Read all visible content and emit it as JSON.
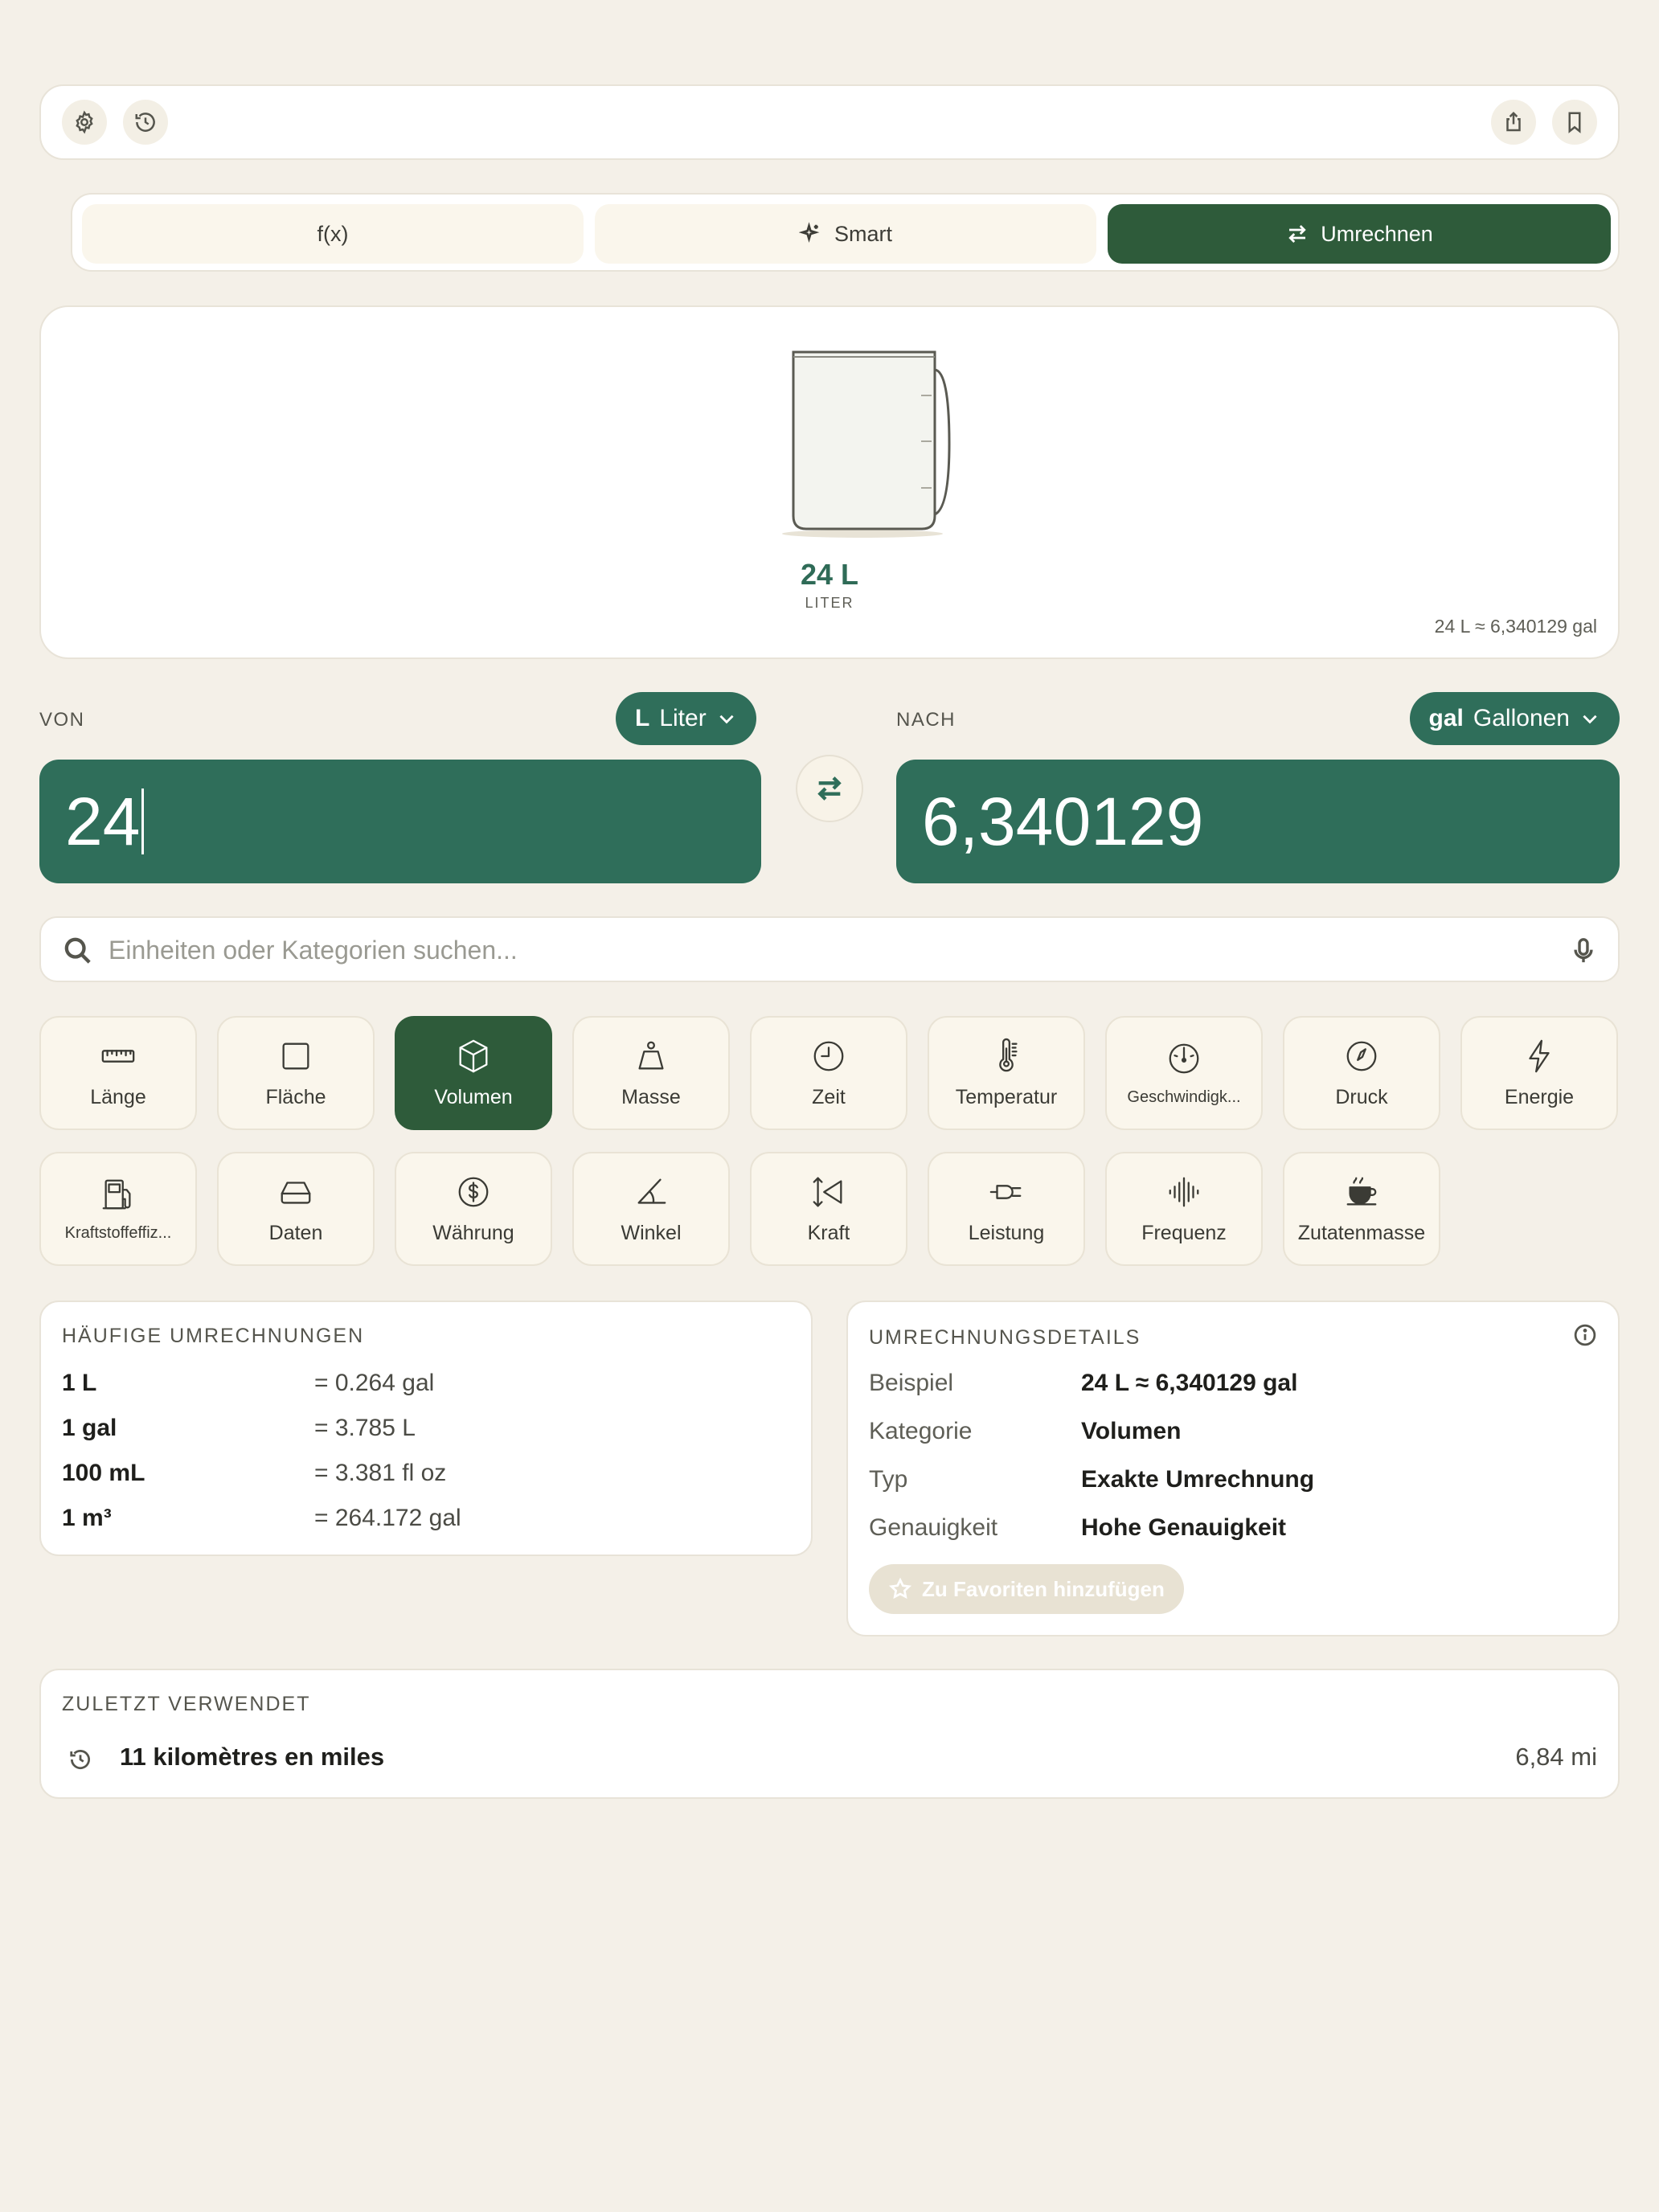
{
  "mode_tabs": [
    {
      "label": "f(x)"
    },
    {
      "label": "Smart"
    },
    {
      "label": "Umrechnen"
    }
  ],
  "visual": {
    "value": "24 L",
    "unit": "LITER",
    "approx": "24 L ≈ 6,340129 gal"
  },
  "from": {
    "label": "VON",
    "unit_symbol": "L",
    "unit_name": "Liter",
    "value": "24"
  },
  "to": {
    "label": "NACH",
    "unit_symbol": "gal",
    "unit_name": "Gallonen",
    "value": "6,340129"
  },
  "search": {
    "placeholder": "Einheiten oder Kategorien suchen..."
  },
  "categories": [
    {
      "label": "Länge",
      "icon": "ruler-icon"
    },
    {
      "label": "Fläche",
      "icon": "square-icon"
    },
    {
      "label": "Volumen",
      "icon": "cube-icon",
      "active": true
    },
    {
      "label": "Masse",
      "icon": "weight-icon"
    },
    {
      "label": "Zeit",
      "icon": "clock-icon"
    },
    {
      "label": "Temperatur",
      "icon": "thermometer-icon"
    },
    {
      "label": "Geschwindigk...",
      "icon": "speedometer-icon"
    },
    {
      "label": "Druck",
      "icon": "gauge-icon"
    },
    {
      "label": "Energie",
      "icon": "bolt-icon"
    },
    {
      "label": "Kraftstoffeffiz...",
      "icon": "fuel-icon"
    },
    {
      "label": "Daten",
      "icon": "drive-icon"
    },
    {
      "label": "Währung",
      "icon": "dollar-icon"
    },
    {
      "label": "Winkel",
      "icon": "angle-icon"
    },
    {
      "label": "Kraft",
      "icon": "force-icon"
    },
    {
      "label": "Leistung",
      "icon": "plug-icon"
    },
    {
      "label": "Frequenz",
      "icon": "waveform-icon"
    },
    {
      "label": "Zutatenmasse",
      "icon": "cup-icon"
    }
  ],
  "common": {
    "title": "HÄUFIGE UMRECHNUNGEN",
    "rows": [
      {
        "from": "1 L",
        "to": "= 0.264 gal"
      },
      {
        "from": "1 gal",
        "to": "= 3.785 L"
      },
      {
        "from": "100 mL",
        "to": "= 3.381 fl oz"
      },
      {
        "from": "1 m³",
        "to": "= 264.172 gal"
      }
    ]
  },
  "details": {
    "title": "UMRECHNUNGSDETAILS",
    "rows": [
      {
        "key": "Beispiel",
        "value": "24 L ≈ 6,340129 gal"
      },
      {
        "key": "Kategorie",
        "value": "Volumen"
      },
      {
        "key": "Typ",
        "value": "Exakte Umrechnung"
      },
      {
        "key": "Genauigkeit",
        "value": "Hohe Genauigkeit"
      }
    ],
    "favorite_label": "Zu Favoriten hinzufügen"
  },
  "recent": {
    "title": "ZULETZT VERWENDET",
    "item_label": "11 kilomètres en miles",
    "item_value": "6,84 mi"
  },
  "colors": {
    "accent": "#2e5b3a",
    "value_box": "#2f6e5a",
    "background": "#f4f0e8"
  }
}
